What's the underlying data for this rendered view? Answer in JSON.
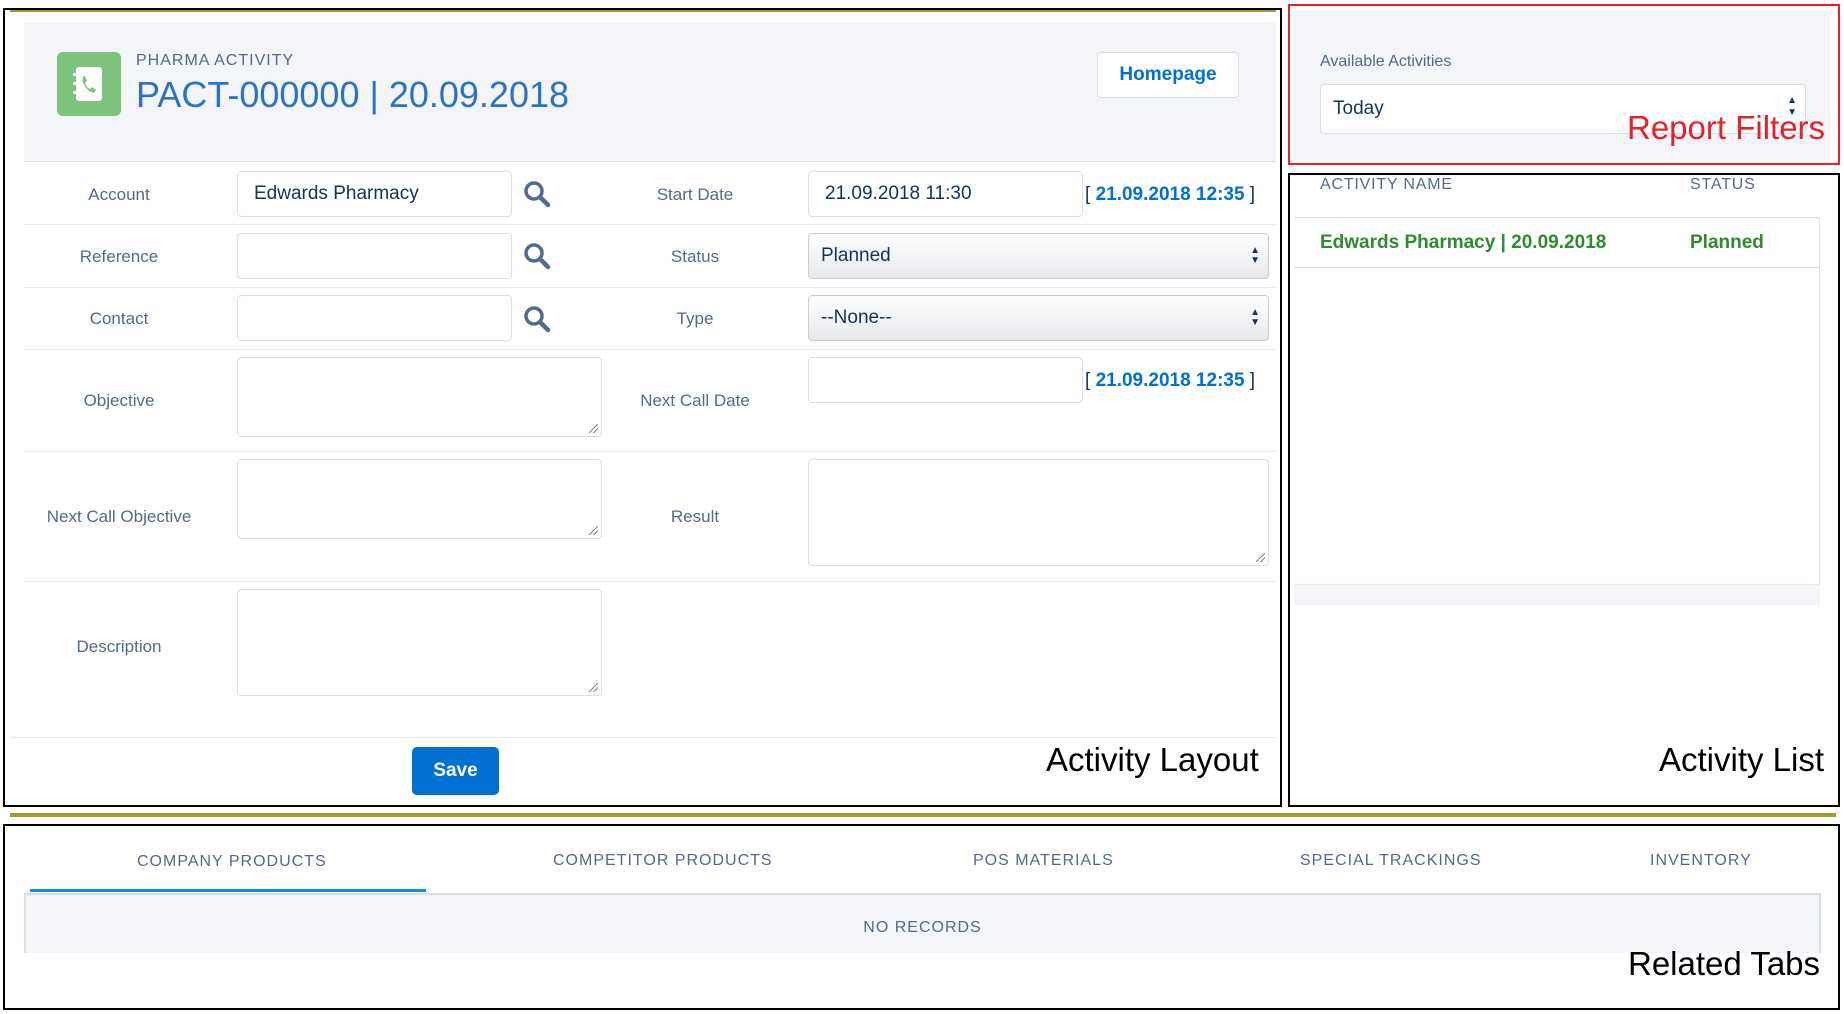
{
  "header": {
    "object_label": "PHARMA ACTIVITY",
    "title": "PACT-000000 | 20.09.2018",
    "homepage_label": "Homepage",
    "icon": "phone-book-icon"
  },
  "form": {
    "account_label": "Account",
    "account_value": "Edwards Pharmacy",
    "reference_label": "Reference",
    "reference_value": "",
    "contact_label": "Contact",
    "contact_value": "",
    "objective_label": "Objective",
    "next_call_objective_label": "Next Call Objective",
    "description_label": "Description",
    "start_date_label": "Start Date",
    "start_date_value": "21.09.2018 11:30",
    "start_date_link": "21.09.2018 12:35",
    "status_label": "Status",
    "status_value": "Planned",
    "type_label": "Type",
    "type_value": "--None--",
    "next_call_date_label": "Next Call Date",
    "next_call_date_value": "",
    "next_call_date_link": "21.09.2018 12:35",
    "result_label": "Result",
    "save_label": "Save"
  },
  "filters": {
    "label": "Available Activities",
    "selected": "Today"
  },
  "activity_list": {
    "columns": [
      "ACTIVITY NAME",
      "STATUS"
    ],
    "rows": [
      {
        "name": "Edwards Pharmacy | 20.09.2018",
        "status": "Planned"
      }
    ]
  },
  "tabs": {
    "items": [
      "COMPANY PRODUCTS",
      "COMPETITOR PRODUCTS",
      "POS MATERIALS",
      "SPECIAL TRACKINGS",
      "INVENTORY"
    ],
    "active": "COMPANY PRODUCTS",
    "empty_text": "NO RECORDS"
  },
  "annotations": {
    "activity_layout": "Activity Layout",
    "report_filters": "Report Filters",
    "activity_list": "Activity List",
    "related_tabs": "Related Tabs"
  },
  "colors": {
    "accent": "#0070d2",
    "title_blue": "#2a73c8",
    "icon_green": "#7dc37d",
    "list_green": "#2e8b2e",
    "annotation_red": "#e8202a",
    "divider_olive": "#a39a2e"
  }
}
